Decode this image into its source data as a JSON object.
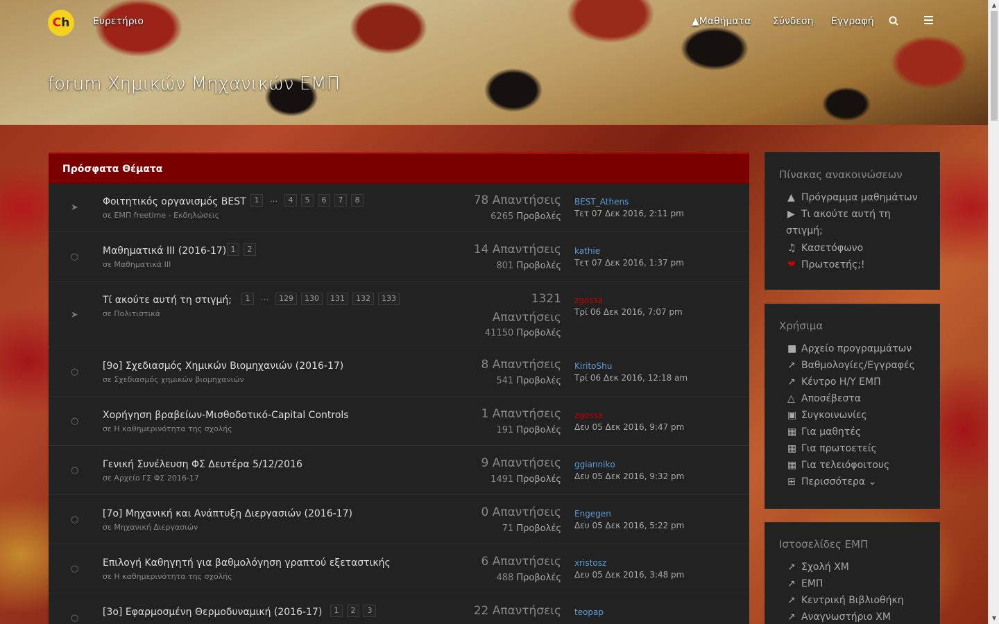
{
  "header": {
    "logo_text": "Ch",
    "nav_index": "Ευρετήριο",
    "nav_courses": "Μαθήματα",
    "nav_login": "Σύνδεση",
    "nav_register": "Εγγραφή",
    "site_title": "forum Χημικών Μηχανικών ΕΜΠ"
  },
  "panel_title": "Πρόσφατα Θέματα",
  "topics": [
    {
      "title": "Φοιτητικός οργανισμός BEST",
      "pages": [
        "1",
        "…",
        "4",
        "5",
        "6",
        "7",
        "8"
      ],
      "forum": "σε ΕΜΠ freetime - Εκδηλώσεις",
      "replies": "78 Απαντήσεις",
      "views": "6265",
      "views_label": "Προβολές",
      "user": "BEST_Athens",
      "date": "Τετ 07 Δεκ 2016, 2:11 pm",
      "icon": "pin-icon"
    },
    {
      "title": "Μαθηματικά ΙΙΙ (2016-17)",
      "pages": [
        "1",
        "2"
      ],
      "forum": "σε Μαθηματικά ΙΙΙ",
      "replies": "14 Απαντήσεις",
      "views": "801",
      "views_label": "Προβολές",
      "user": "kathie",
      "date": "Τετ 07 Δεκ 2016, 1:37 pm",
      "icon": "comment-icon"
    },
    {
      "title": "Τί ακούτε αυτή τη στιγμή;",
      "pages": [
        "1",
        "…",
        "129",
        "130",
        "131",
        "132",
        "133"
      ],
      "forum": "σε Πολιτιστικά",
      "replies_num": "1321",
      "replies_word": "Απαντήσεις",
      "views": "41150",
      "views_label": "Προβολές",
      "user": "zgossa",
      "date": "Τρί 06 Δεκ 2016, 7:07 pm",
      "icon": "pin-icon"
    },
    {
      "title": "[9ο] Σχεδιασμός Χημικών Βιομηχανιών (2016-17)",
      "pages": [],
      "forum": "σε Σχεδιασμός χημικών βιομηχανιών",
      "replies": "8 Απαντήσεις",
      "views": "541",
      "views_label": "Προβολές",
      "user": "KiritoShu",
      "date": "Τρί 06 Δεκ 2016, 12:18 am",
      "icon": "comment-icon"
    },
    {
      "title": "Χορήγηση βραβείων-Μισθοδοτικό-Capital Controls",
      "pages": [],
      "forum": "σε Η καθημερινότητα της σχολής",
      "replies": "1 Απαντήσεις",
      "views": "191",
      "views_label": "Προβολές",
      "user": "zgossa",
      "date": "Δευ 05 Δεκ 2016, 9:47 pm",
      "icon": "comment-icon"
    },
    {
      "title": "Γενική Συνέλευση ΦΣ Δευτέρα 5/12/2016",
      "pages": [],
      "forum": "σε Αρχείο ΓΣ ΦΣ 2016-17",
      "replies": "9 Απαντήσεις",
      "views": "1491",
      "views_label": "Προβολές",
      "user": "ggiannikо",
      "date": "Δευ 05 Δεκ 2016, 9:32 pm",
      "icon": "comment-icon"
    },
    {
      "title": "[7ο] Μηχανική και Ανάπτυξη Διεργασιών (2016-17)",
      "pages": [],
      "forum": "σε Μηχανική Διεργασιών",
      "replies": "0 Απαντήσεις",
      "views": "71",
      "views_label": "Προβολές",
      "user": "Engegen",
      "date": "Δευ 05 Δεκ 2016, 5:22 pm",
      "icon": "comment-icon"
    },
    {
      "title": "Επιλογή Καθηγητή για βαθμολόγηση γραπτού εξεταστικής",
      "pages": [],
      "forum": "σε Η καθημερινότητα της σχολής",
      "replies": "6 Απαντήσεις",
      "views": "488",
      "views_label": "Προβολές",
      "user": "xristosz",
      "date": "Δευ 05 Δεκ 2016, 3:48 pm",
      "icon": "comment-icon"
    },
    {
      "title": "[3ο] Εφαρμοσμένη Θερμοδυναμική (2016-17)",
      "pages": [
        "1",
        "2",
        "3"
      ],
      "forum": "",
      "replies": "22 Απαντήσεις",
      "views": "",
      "views_label": "",
      "user": "teopap",
      "date": "",
      "icon": "comment-icon"
    }
  ],
  "sidebar": {
    "announcements": {
      "title": "Πίνακας ανακοινώσεων",
      "items": [
        {
          "label": "Πρόγραμμα μαθημάτων",
          "icon": "graduation-cap-icon"
        },
        {
          "label": "Τι ακούτε αυτή τη",
          "icon": "play-circle-icon"
        },
        {
          "label": "στιγμή;",
          "icon": ""
        },
        {
          "label": "Κασετόφωνο",
          "icon": "music-icon"
        },
        {
          "label": "Πρωτοετής;!",
          "icon": "heart-icon"
        }
      ]
    },
    "useful": {
      "title": "Χρήσιμα",
      "items": [
        {
          "label": "Αρχείο προγραμμάτων",
          "icon": "archive-icon"
        },
        {
          "label": "Βαθμολογίες/Εγγραφές",
          "icon": "external-link-icon"
        },
        {
          "label": "Κέντρο Η/Υ ΕΜΠ",
          "icon": "external-link-icon"
        },
        {
          "label": "Αποσέβεστα",
          "icon": "flask-icon"
        },
        {
          "label": "Συγκοινωνίες",
          "icon": "bus-icon"
        },
        {
          "label": "Για μαθητές",
          "icon": "map-icon"
        },
        {
          "label": "Για πρωτοετείς",
          "icon": "map-icon"
        },
        {
          "label": "Για τελειόφοιτους",
          "icon": "map-icon"
        },
        {
          "label": "Περισσότερα",
          "icon": "plus-square-icon"
        }
      ]
    },
    "sites": {
      "title": "Ιστοσελίδες ΕΜΠ",
      "items": [
        {
          "label": "Σχολή ΧΜ",
          "icon": "external-link-icon"
        },
        {
          "label": "ΕΜΠ",
          "icon": "external-link-icon"
        },
        {
          "label": "Κεντρική Βιβλιοθήκη",
          "icon": "external-link-icon"
        },
        {
          "label": "Αναγνωστήριο ΧΜ",
          "icon": "external-link-icon"
        }
      ]
    }
  }
}
